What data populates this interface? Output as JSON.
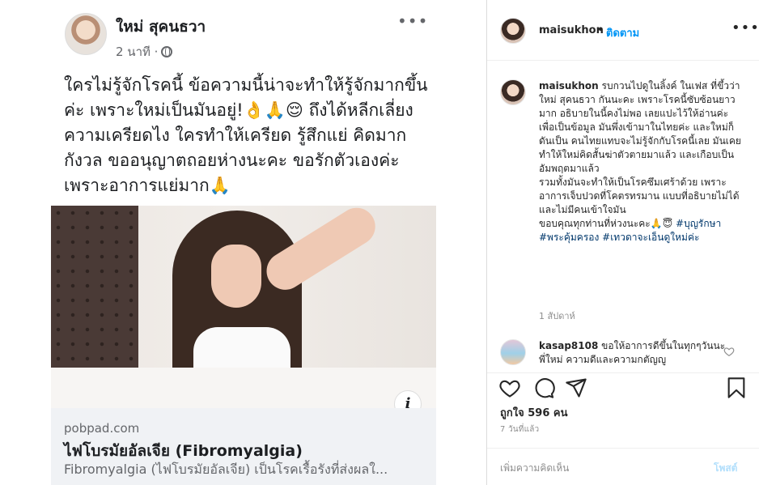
{
  "facebook_post": {
    "author": "ใหม่ สุคนธวา",
    "time": "2 นาที ·",
    "more_icon": "•••",
    "text": "ใครไม่รู้จักโรคนี้ ข้อความนี้น่าจะทำให้รู้จักมากขึ้น\nค่ะ เพราะใหม่เป็นมันอยู่!👌🙏😌 ถึงได้หลีกเลี่ยง\nความเครียดไง ใครทำให้เครียด รู้สึกแย่ คิดมาก\nกังวล ขออนุญาตถอยห่างนะคะ ขอรักตัวเองค่ะ\nเพราะอาการแย่มาก🙏",
    "info_icon": "i",
    "link": {
      "domain": "pobpad.com",
      "title": "ไฟโบรมัยอัลเจีย (Fibromyalgia)",
      "description": "Fibromyalgia (ไฟโบรมัยอัลเจีย) เป็นโรคเรื้อรังที่ส่งผลใ..."
    }
  },
  "instagram": {
    "header": {
      "username": "maisukhon",
      "dot": "•",
      "follow_label": "ติดตาม",
      "more_icon": "•••"
    },
    "caption": {
      "username": "maisukhon",
      "text": " รบกวนไปดูในลิ้งค์ ในเฟส ที่ขึ้วว่า\nใหม่ สุคนธวา กันนะคะ เพราะโรคนี้ซับซ้อนยาวมาก อธิบายในนี้คงไม่พอ เลยแปะไว้ให้อ่านค่ะ เพื่อเป็นข้อมูล มันพึ่งเข้ามาในไทยค่ะ และใหม่ก็ดันเป็น คนไทยแทบจะไม่รู้จักกับโรคนี้เลย มันเคยทำให้ใหม่คิดสั้นฆ่าตัวตายมาแล้ว และเกือบเป็นอัมพฤตมาแล้ว\nรวมทั้งมันจะทำให้เป็นโรคซึมเศร้าด้วย เพราะอาการเจ็บปวดที่โคตรทรมาน แบบที่อธิบายไม่ได้ และไม่มีคนเข้าใจมัน\nขอบคุณทุกท่านที่ห่วงนะคะ🙏😇 ",
      "hashtags": "#บุญรักษา #พระคุ้มครอง #เทวดาจะเอ็นดูใหม่ค่ะ",
      "time": "1 สัปดาห์"
    },
    "comment": {
      "username": "kasap8108",
      "text": " ขอให้อาการดีขึ้นในทุกๆวันนะ พี่ใหม่ ความดีและความกตัญญู"
    },
    "likes": "ถูกใจ 596 คน",
    "post_time": "7 วันที่แล้ว",
    "comment_placeholder": "เพิ่มความคิดเห็น",
    "post_label": "โพสต์"
  }
}
